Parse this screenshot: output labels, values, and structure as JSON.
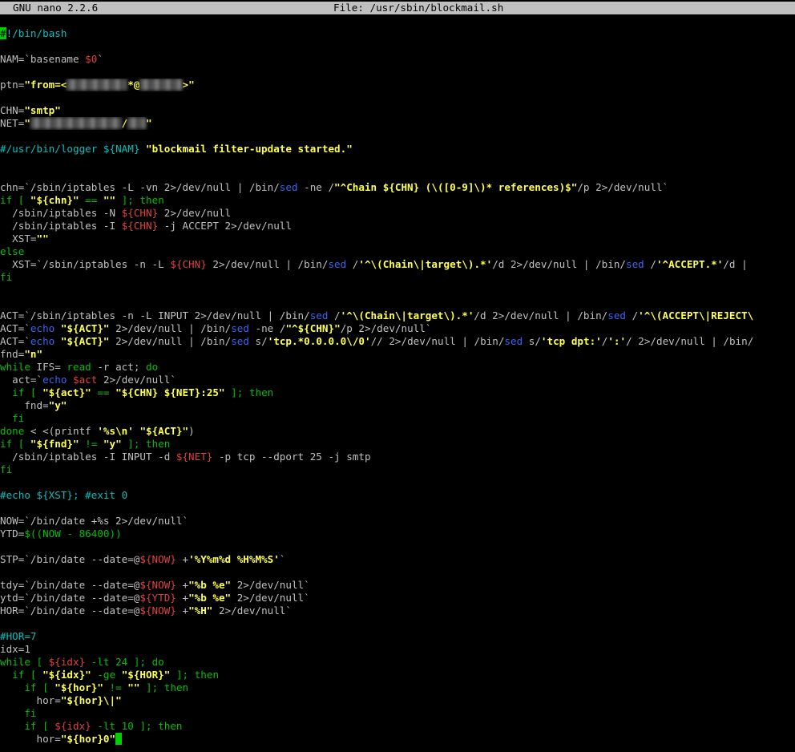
{
  "titlebar": {
    "app": "GNU nano 2.2.6",
    "file": "File: /usr/sbin/blockmail.sh"
  },
  "colors": {
    "background": "#000000",
    "default_text": "#c0c0c0",
    "keyword_green": "#00c000",
    "string_yellow": "#ffff50",
    "variable_red": "#e04040",
    "command_blue": "#3c64f0",
    "comment_cyan": "#00c0c0",
    "cursor": "#00d000"
  },
  "lines": [
    [
      {
        "t": "#",
        "c": "cursor-first"
      },
      {
        "t": "!/bin/bash",
        "c": "c"
      }
    ],
    [],
    [
      {
        "t": "NAM=`basename ",
        "c": "w"
      },
      {
        "t": "$0",
        "c": "r"
      },
      {
        "t": "`",
        "c": "w"
      }
    ],
    [],
    [
      {
        "t": "ptn=",
        "c": "w"
      },
      {
        "t": "\"from=<",
        "c": "y"
      },
      {
        "t": "xxxxxxxxxx",
        "c": "blur"
      },
      {
        "t": "*@",
        "c": "y"
      },
      {
        "t": "xxxxxxx",
        "c": "blur"
      },
      {
        "t": ">\"",
        "c": "y"
      }
    ],
    [],
    [
      {
        "t": "CHN=",
        "c": "w"
      },
      {
        "t": "\"smtp\"",
        "c": "y"
      }
    ],
    [
      {
        "t": "NET=",
        "c": "w"
      },
      {
        "t": "\"",
        "c": "y"
      },
      {
        "t": "xxxxxxxxxxxxxxx",
        "c": "blur"
      },
      {
        "t": "/",
        "c": "y"
      },
      {
        "t": "xxx",
        "c": "blur"
      },
      {
        "t": "\"",
        "c": "y"
      }
    ],
    [],
    [
      {
        "t": "#/usr/bin/logger ",
        "c": "c"
      },
      {
        "t": "${NAM}",
        "c": "c"
      },
      {
        "t": " ",
        "c": "w"
      },
      {
        "t": "\"blockmail filter-update started.\"",
        "c": "y"
      }
    ],
    [],
    [],
    [
      {
        "t": "chn=`/sbin/iptables -L -vn ",
        "c": "w"
      },
      {
        "t": "2",
        "c": "w"
      },
      {
        "t": ">/dev/null | /bin/",
        "c": "w"
      },
      {
        "t": "sed",
        "c": "b"
      },
      {
        "t": " -ne /",
        "c": "w"
      },
      {
        "t": "\"^Chain ${CHN} (\\([0-9]\\)* references)$\"",
        "c": "y"
      },
      {
        "t": "/p ",
        "c": "w"
      },
      {
        "t": "2",
        "c": "w"
      },
      {
        "t": ">/dev/null`",
        "c": "w"
      }
    ],
    [
      {
        "t": "if",
        "c": "g"
      },
      {
        "t": " [ ",
        "c": "g"
      },
      {
        "t": "\"${chn}\"",
        "c": "y"
      },
      {
        "t": " == ",
        "c": "g"
      },
      {
        "t": "\"\"",
        "c": "y"
      },
      {
        "t": " ]; ",
        "c": "g"
      },
      {
        "t": "then",
        "c": "g"
      }
    ],
    [
      {
        "t": "  /sbin/iptables -N ",
        "c": "w"
      },
      {
        "t": "${CHN}",
        "c": "r"
      },
      {
        "t": " 2>/dev/null",
        "c": "w"
      }
    ],
    [
      {
        "t": "  /sbin/iptables -I ",
        "c": "w"
      },
      {
        "t": "${CHN}",
        "c": "r"
      },
      {
        "t": " -j ACCEPT 2>/dev/null",
        "c": "w"
      }
    ],
    [
      {
        "t": "  XST=",
        "c": "w"
      },
      {
        "t": "\"\"",
        "c": "y"
      }
    ],
    [
      {
        "t": "else",
        "c": "g"
      }
    ],
    [
      {
        "t": "  XST=`/sbin/iptables -n -L ",
        "c": "w"
      },
      {
        "t": "${CHN}",
        "c": "r"
      },
      {
        "t": " 2>/dev/null | /bin/",
        "c": "w"
      },
      {
        "t": "sed",
        "c": "b"
      },
      {
        "t": " /",
        "c": "w"
      },
      {
        "t": "'^\\(Chain\\|target\\).*'",
        "c": "y"
      },
      {
        "t": "/d 2>/dev/null | /bin/",
        "c": "w"
      },
      {
        "t": "sed",
        "c": "b"
      },
      {
        "t": " /",
        "c": "w"
      },
      {
        "t": "'^ACCEPT.*'",
        "c": "y"
      },
      {
        "t": "/d |",
        "c": "w"
      }
    ],
    [
      {
        "t": "fi",
        "c": "g"
      }
    ],
    [],
    [],
    [
      {
        "t": "ACT=`/sbin/iptables -n -L INPUT 2>/dev/null | /bin/",
        "c": "w"
      },
      {
        "t": "sed",
        "c": "b"
      },
      {
        "t": " /",
        "c": "w"
      },
      {
        "t": "'^\\(Chain\\|target\\).*'",
        "c": "y"
      },
      {
        "t": "/d 2>/dev/null | /bin/",
        "c": "w"
      },
      {
        "t": "sed",
        "c": "b"
      },
      {
        "t": " /",
        "c": "w"
      },
      {
        "t": "'^\\(ACCEPT\\|REJECT\\",
        "c": "y"
      }
    ],
    [
      {
        "t": "ACT=`",
        "c": "w"
      },
      {
        "t": "echo",
        "c": "b"
      },
      {
        "t": " ",
        "c": "w"
      },
      {
        "t": "\"${ACT}\"",
        "c": "y"
      },
      {
        "t": " 2>/dev/null | /bin/",
        "c": "w"
      },
      {
        "t": "sed",
        "c": "b"
      },
      {
        "t": " -ne /",
        "c": "w"
      },
      {
        "t": "\"^${CHN}\"",
        "c": "y"
      },
      {
        "t": "/p 2>/dev/null`",
        "c": "w"
      }
    ],
    [
      {
        "t": "ACT=`",
        "c": "w"
      },
      {
        "t": "echo",
        "c": "b"
      },
      {
        "t": " ",
        "c": "w"
      },
      {
        "t": "\"${ACT}\"",
        "c": "y"
      },
      {
        "t": " 2>/dev/null | /bin/",
        "c": "w"
      },
      {
        "t": "sed",
        "c": "b"
      },
      {
        "t": " s/",
        "c": "w"
      },
      {
        "t": "'tcp.*0.0.0.0\\/0'",
        "c": "y"
      },
      {
        "t": "// 2>/dev/null | /bin/",
        "c": "w"
      },
      {
        "t": "sed",
        "c": "b"
      },
      {
        "t": " s/",
        "c": "w"
      },
      {
        "t": "'tcp dpt:'",
        "c": "y"
      },
      {
        "t": "/",
        "c": "w"
      },
      {
        "t": "':'",
        "c": "y"
      },
      {
        "t": "/ 2>/dev/null | /bin/",
        "c": "w"
      }
    ],
    [
      {
        "t": "fnd=",
        "c": "w"
      },
      {
        "t": "\"n\"",
        "c": "y"
      }
    ],
    [
      {
        "t": "while",
        "c": "g"
      },
      {
        "t": " IFS= ",
        "c": "w"
      },
      {
        "t": "read",
        "c": "g"
      },
      {
        "t": " -r act; ",
        "c": "w"
      },
      {
        "t": "do",
        "c": "g"
      }
    ],
    [
      {
        "t": "  act=`",
        "c": "w"
      },
      {
        "t": "echo",
        "c": "b"
      },
      {
        "t": " ",
        "c": "w"
      },
      {
        "t": "$act",
        "c": "r"
      },
      {
        "t": " 2>/dev/null`",
        "c": "w"
      }
    ],
    [
      {
        "t": "  if",
        "c": "g"
      },
      {
        "t": " [ ",
        "c": "g"
      },
      {
        "t": "\"${act}\"",
        "c": "y"
      },
      {
        "t": " == ",
        "c": "g"
      },
      {
        "t": "\"${CHN} ${NET}:25\"",
        "c": "y"
      },
      {
        "t": " ]; ",
        "c": "g"
      },
      {
        "t": "then",
        "c": "g"
      }
    ],
    [
      {
        "t": "    fnd=",
        "c": "w"
      },
      {
        "t": "\"y\"",
        "c": "y"
      }
    ],
    [
      {
        "t": "  fi",
        "c": "g"
      }
    ],
    [
      {
        "t": "done",
        "c": "g"
      },
      {
        "t": " < <(printf ",
        "c": "w"
      },
      {
        "t": "'%s\\n'",
        "c": "y"
      },
      {
        "t": " ",
        "c": "w"
      },
      {
        "t": "\"${ACT}\"",
        "c": "y"
      },
      {
        "t": ")",
        "c": "w"
      }
    ],
    [
      {
        "t": "if",
        "c": "g"
      },
      {
        "t": " [ ",
        "c": "g"
      },
      {
        "t": "\"${fnd}\"",
        "c": "y"
      },
      {
        "t": " != ",
        "c": "g"
      },
      {
        "t": "\"y\"",
        "c": "y"
      },
      {
        "t": " ]; ",
        "c": "g"
      },
      {
        "t": "then",
        "c": "g"
      }
    ],
    [
      {
        "t": "  /sbin/iptables -I INPUT -d ",
        "c": "w"
      },
      {
        "t": "${NET}",
        "c": "r"
      },
      {
        "t": " -p tcp --dport 25 -j smtp",
        "c": "w"
      }
    ],
    [
      {
        "t": "fi",
        "c": "g"
      }
    ],
    [],
    [
      {
        "t": "#echo ${XST}; #exit 0",
        "c": "c"
      }
    ],
    [],
    [
      {
        "t": "NOW=`/bin/date +%s 2>/dev/null`",
        "c": "w"
      }
    ],
    [
      {
        "t": "YTD=",
        "c": "w"
      },
      {
        "t": "$((NOW - 86400))",
        "c": "g"
      }
    ],
    [],
    [
      {
        "t": "STP=`/bin/date --date=@",
        "c": "w"
      },
      {
        "t": "${NOW}",
        "c": "r"
      },
      {
        "t": " +",
        "c": "w"
      },
      {
        "t": "'%Y%m%d %H%M%S'",
        "c": "y"
      },
      {
        "t": "`",
        "c": "w"
      }
    ],
    [],
    [
      {
        "t": "tdy=`/bin/date --date=@",
        "c": "w"
      },
      {
        "t": "${NOW}",
        "c": "r"
      },
      {
        "t": " +",
        "c": "w"
      },
      {
        "t": "\"%b %e\"",
        "c": "y"
      },
      {
        "t": " 2>/dev/null`",
        "c": "w"
      }
    ],
    [
      {
        "t": "ytd=`/bin/date --date=@",
        "c": "w"
      },
      {
        "t": "${YTD}",
        "c": "r"
      },
      {
        "t": " +",
        "c": "w"
      },
      {
        "t": "\"%b %e\"",
        "c": "y"
      },
      {
        "t": " 2>/dev/null`",
        "c": "w"
      }
    ],
    [
      {
        "t": "HOR=`/bin/date --date=@",
        "c": "w"
      },
      {
        "t": "${NOW}",
        "c": "r"
      },
      {
        "t": " +",
        "c": "w"
      },
      {
        "t": "\"%H\"",
        "c": "y"
      },
      {
        "t": " 2>/dev/null`",
        "c": "w"
      }
    ],
    [],
    [
      {
        "t": "#HOR=7",
        "c": "c"
      }
    ],
    [
      {
        "t": "idx=1",
        "c": "w"
      }
    ],
    [
      {
        "t": "while",
        "c": "g"
      },
      {
        "t": " [ ",
        "c": "g"
      },
      {
        "t": "${idx}",
        "c": "r"
      },
      {
        "t": " -lt 24 ]; ",
        "c": "g"
      },
      {
        "t": "do",
        "c": "g"
      }
    ],
    [
      {
        "t": "  if",
        "c": "g"
      },
      {
        "t": " [ ",
        "c": "g"
      },
      {
        "t": "\"${idx}\"",
        "c": "y"
      },
      {
        "t": " -ge ",
        "c": "g"
      },
      {
        "t": "\"${HOR}\"",
        "c": "y"
      },
      {
        "t": " ]; ",
        "c": "g"
      },
      {
        "t": "then",
        "c": "g"
      }
    ],
    [
      {
        "t": "    if",
        "c": "g"
      },
      {
        "t": " [ ",
        "c": "g"
      },
      {
        "t": "\"${hor}\"",
        "c": "y"
      },
      {
        "t": " != ",
        "c": "g"
      },
      {
        "t": "\"\"",
        "c": "y"
      },
      {
        "t": " ]; ",
        "c": "g"
      },
      {
        "t": "then",
        "c": "g"
      }
    ],
    [
      {
        "t": "      hor=",
        "c": "w"
      },
      {
        "t": "\"${hor}\\|\"",
        "c": "y"
      }
    ],
    [
      {
        "t": "    fi",
        "c": "g"
      }
    ],
    [
      {
        "t": "    if",
        "c": "g"
      },
      {
        "t": " [ ",
        "c": "g"
      },
      {
        "t": "${idx}",
        "c": "r"
      },
      {
        "t": " -lt 10 ]; ",
        "c": "g"
      },
      {
        "t": "then",
        "c": "g"
      }
    ],
    [
      {
        "t": "      hor=",
        "c": "w"
      },
      {
        "t": "\"${hor}0\"",
        "c": "y"
      },
      {
        "t": "",
        "c": "cursor"
      }
    ]
  ]
}
